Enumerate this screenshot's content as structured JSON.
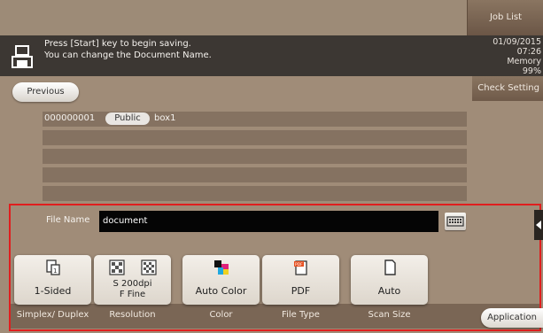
{
  "header": {
    "job_list": "Job List",
    "message_line1": "Press [Start] key to begin saving.",
    "message_line2": "You can change the Document Name.",
    "date": "01/09/2015",
    "time": "07:26",
    "memory_label": "Memory",
    "memory_value": "99%"
  },
  "nav": {
    "previous": "Previous",
    "check_setting": "Check Setting"
  },
  "box_list": {
    "rows": [
      {
        "number": "000000001",
        "type": "Public",
        "name": "box1"
      },
      {
        "number": "",
        "type": "",
        "name": ""
      },
      {
        "number": "",
        "type": "",
        "name": ""
      },
      {
        "number": "",
        "type": "",
        "name": ""
      },
      {
        "number": "",
        "type": "",
        "name": ""
      }
    ]
  },
  "file_name": {
    "label": "File Name",
    "value": "document"
  },
  "settings": [
    {
      "value": "1-Sided",
      "caption": "Simplex/ Duplex",
      "icon": "simplex-icon"
    },
    {
      "value": "S 200dpi F Fine",
      "caption": "Resolution",
      "icon": "resolution-icon"
    },
    {
      "value": "Auto Color",
      "caption": "Color",
      "icon": "auto-color-icon"
    },
    {
      "value": "PDF",
      "caption": "File Type",
      "icon": "pdf-icon"
    },
    {
      "value": "Auto",
      "caption": "Scan Size",
      "icon": "page-icon"
    }
  ],
  "application": "Application",
  "colors": {
    "highlight_frame": "#e01e1e",
    "panel": "#a08c78",
    "message_bar": "#3c3733"
  }
}
